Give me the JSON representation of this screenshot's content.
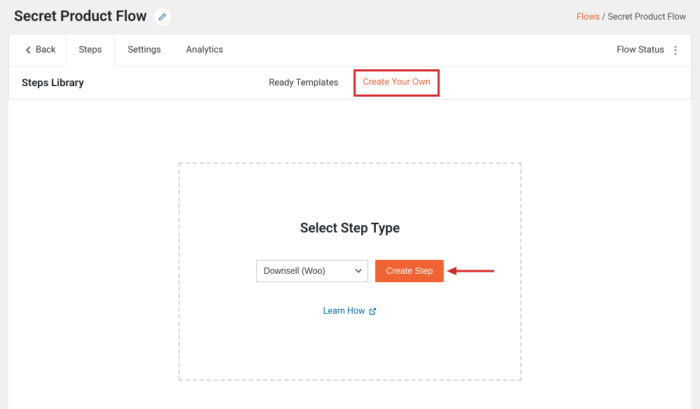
{
  "header": {
    "title": "Secret Product Flow",
    "breadcrumb_link": "Flows",
    "breadcrumb_current": "Secret Product Flow"
  },
  "nav": {
    "back_label": "Back",
    "tabs": [
      "Steps",
      "Settings",
      "Analytics"
    ],
    "flow_status_label": "Flow Status"
  },
  "subheader": {
    "title": "Steps Library",
    "subtabs": [
      "Ready Templates",
      "Create Your Own"
    ]
  },
  "step": {
    "heading": "Select Step Type",
    "selected_option": "Downsell (Woo)",
    "create_button": "Create Step",
    "learn_link": "Learn How"
  },
  "colors": {
    "accent": "#f06434",
    "highlight": "#d62828",
    "link": "#006ba1"
  }
}
